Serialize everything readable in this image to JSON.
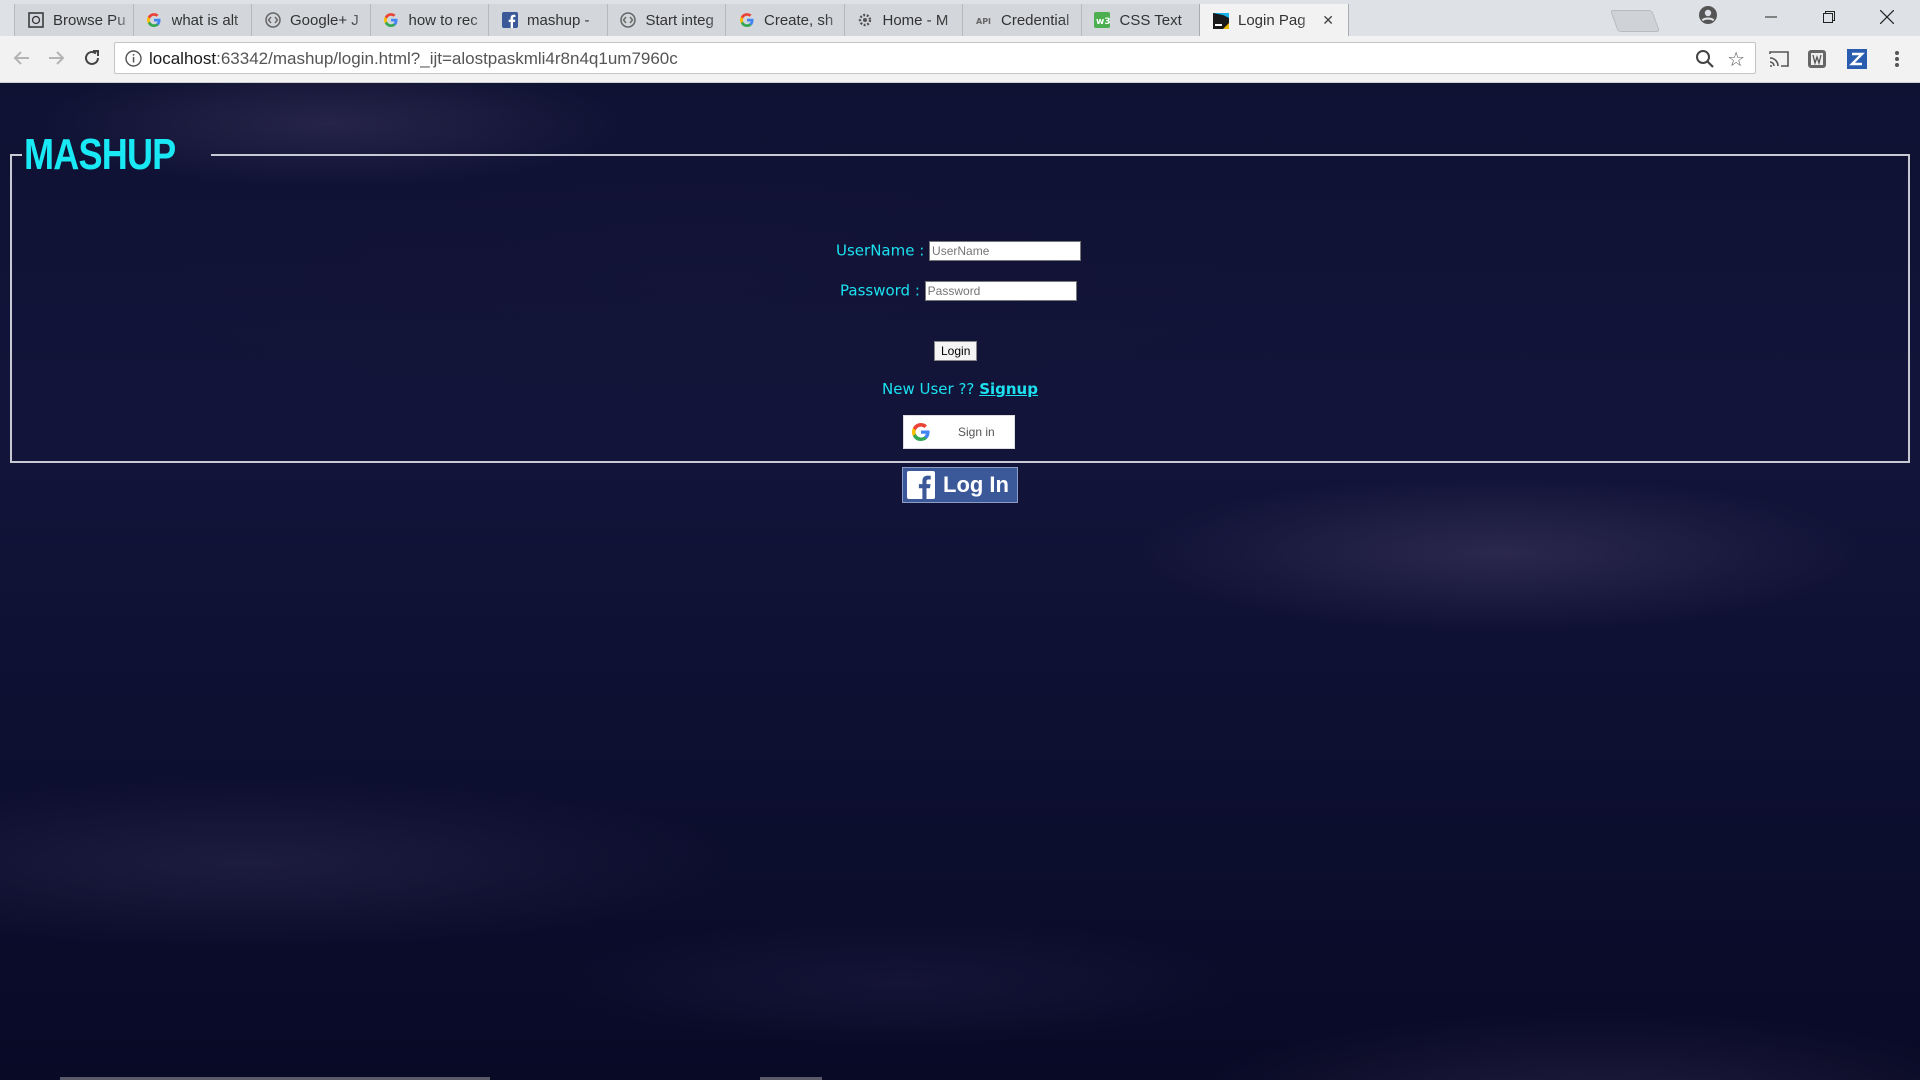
{
  "browser": {
    "tabs": [
      {
        "title": "Browse Pu",
        "icon": "globe-icon"
      },
      {
        "title": "what is alt",
        "icon": "google-icon"
      },
      {
        "title": "Google+ J",
        "icon": "google-dev-icon"
      },
      {
        "title": "how to rec",
        "icon": "google-icon"
      },
      {
        "title": "mashup -",
        "icon": "facebook-icon"
      },
      {
        "title": "Start integ",
        "icon": "google-dev-icon"
      },
      {
        "title": "Create, sh",
        "icon": "google-icon"
      },
      {
        "title": "Home - M",
        "icon": "gear-icon"
      },
      {
        "title": "Credential",
        "icon": "api-icon",
        "prefix": "API"
      },
      {
        "title": "CSS Text",
        "icon": "w3-icon"
      },
      {
        "title": "Login Pag",
        "icon": "webstorm-icon",
        "active": true
      }
    ],
    "url_host": "localhost",
    "url_rest": ":63342/mashup/login.html?_ijt=alostpaskmli4r8n4q1um7960c"
  },
  "page": {
    "logo": "MASHUP",
    "username_label": "UserName :",
    "username_placeholder": "UserName",
    "password_label": "Password :",
    "password_placeholder": "Password",
    "login_button": "Login",
    "new_user_text": "New User ??",
    "signup_link": "Signup",
    "google_signin": "Sign in",
    "facebook_login": "Log In"
  },
  "colors": {
    "accent": "#1ce1ef",
    "logo": "#19e9f4",
    "facebook": "#3b5998",
    "background": "#0f1233"
  }
}
